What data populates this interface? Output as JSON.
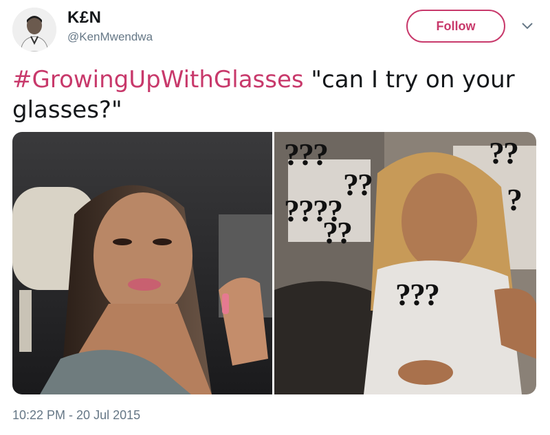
{
  "author": {
    "display_name": "K£N",
    "handle": "@KenMwendwa",
    "avatar_icon": "profile-avatar"
  },
  "follow_button": {
    "label": "Follow",
    "color": "#c8396b"
  },
  "menu_icon": "chevron-down-icon",
  "tweet": {
    "hashtag": "#GrowingUpWithGlasses",
    "text": " \"can I try on your glasses?\""
  },
  "media": {
    "left_image": "woman-in-car-side-glance-photo",
    "right_image": "confused-woman-with-question-marks-photo",
    "question_marks": [
      "???",
      "??",
      "??",
      "????",
      "??",
      "?",
      "???"
    ]
  },
  "timestamp": "10:22 PM - 20 Jul 2015",
  "colors": {
    "accent": "#c8396b",
    "muted": "#657786",
    "text": "#14171a"
  }
}
